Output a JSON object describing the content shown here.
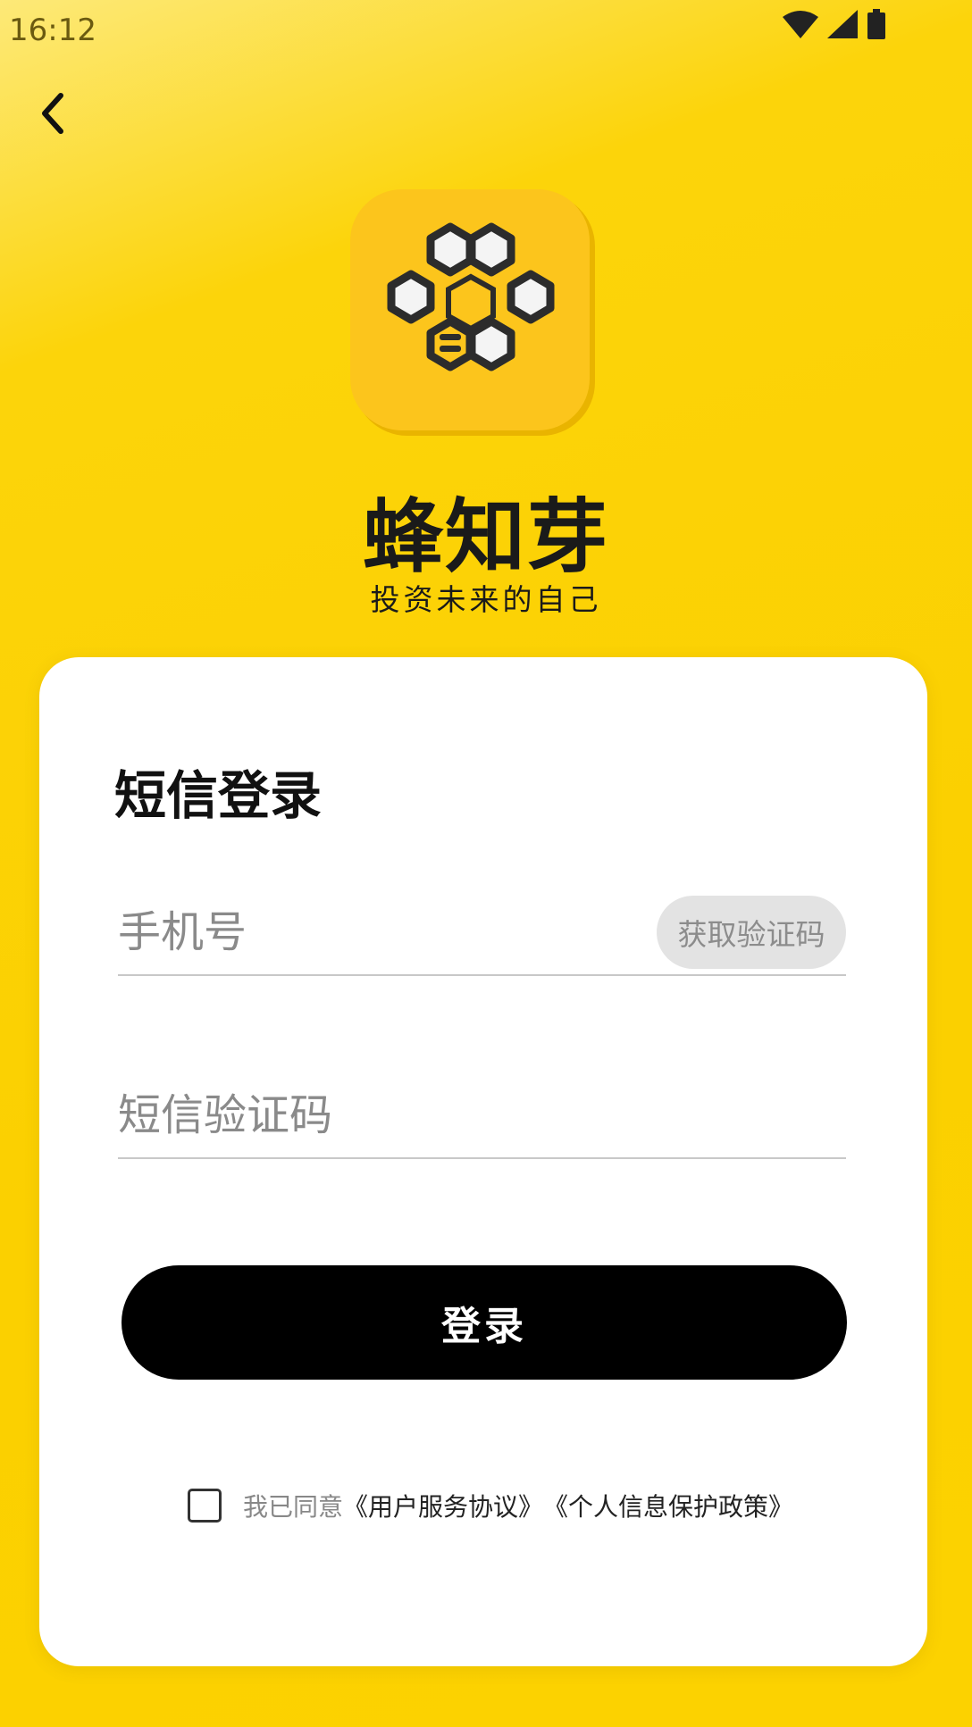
{
  "status_bar": {
    "time": "16:12",
    "icons": [
      "wifi-icon",
      "cellular-icon",
      "battery-icon"
    ]
  },
  "nav": {
    "back_icon": "chevron-left-icon"
  },
  "brand": {
    "name": "蜂知芽",
    "slogan": "投资未来的自己",
    "logo_icon": "honeycomb-logo"
  },
  "login": {
    "title": "短信登录",
    "phone_placeholder": "手机号",
    "get_code_label": "获取验证码",
    "code_placeholder": "短信验证码",
    "submit_label": "登录",
    "agreement": {
      "prefix": "我已同意",
      "user_agreement": "《用户服务协议》",
      "privacy_policy": "《个人信息保护政策》",
      "checked": false
    }
  },
  "colors": {
    "background": "#fcd200",
    "card": "#ffffff",
    "button": "#000000",
    "button_text": "#ffffff",
    "get_code_bg": "#e3e3e3"
  }
}
